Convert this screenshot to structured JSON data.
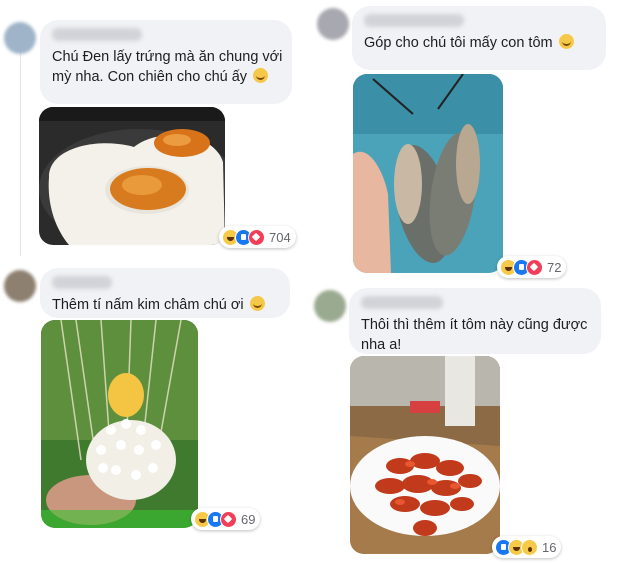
{
  "comments": [
    {
      "text": "Chú Đen lấy trứng mà ăn chung với mỳ nha. Con chiên cho chú ấy",
      "photo": "fried-eggs-photo",
      "reaction_count": "704",
      "reactions": [
        "haha",
        "like",
        "love"
      ]
    },
    {
      "text": "Góp cho chú tôi mấy con tôm",
      "photo": "shrimp-in-hand-photo",
      "reaction_count": "72",
      "reactions": [
        "haha",
        "like",
        "love"
      ]
    },
    {
      "text": "Thêm tí nấm kim châm chú ơi",
      "photo": "enoki-mushroom-photo",
      "reaction_count": "69",
      "reactions": [
        "haha",
        "like",
        "love"
      ]
    },
    {
      "text": "Thôi thì thêm ít tôm này cũng được nha a!",
      "photo": "crayfish-plate-photo",
      "reaction_count": "16",
      "reactions": [
        "like",
        "haha",
        "wow"
      ]
    }
  ],
  "colors": {
    "bubble": "#f0f2f5",
    "like": "#1877f2",
    "love": "#f33e58",
    "haha": "#f7c948"
  }
}
